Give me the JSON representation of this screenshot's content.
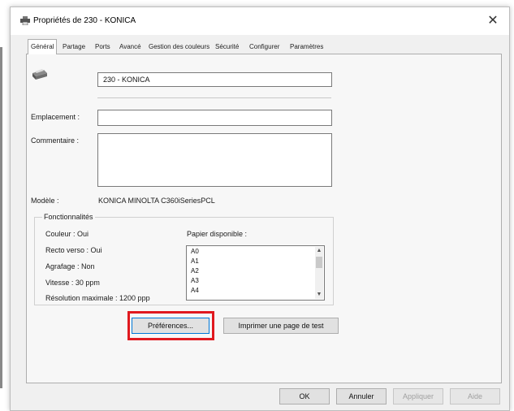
{
  "window": {
    "title": "Propriétés de 230 - KONICA",
    "close_symbol": "✕",
    "title_icon": "printer-icon"
  },
  "tabs": [
    {
      "label": "Général",
      "active": true
    },
    {
      "label": "Partage"
    },
    {
      "label": "Ports"
    },
    {
      "label": "Avancé"
    },
    {
      "label": "Gestion des couleurs"
    },
    {
      "label": "Sécurité"
    },
    {
      "label": "Configurer"
    },
    {
      "label": "Paramètres"
    }
  ],
  "general": {
    "printer_name": "230 - KONICA",
    "location_label": "Emplacement :",
    "location_value": "",
    "comment_label": "Commentaire :",
    "comment_value": "",
    "model_label": "Modèle :",
    "model_value": "KONICA MINOLTA C360iSeriesPCL",
    "features": {
      "title": "Fonctionnalités",
      "color": "Couleur : Oui",
      "duplex": "Recto verso : Oui",
      "staple": "Agrafage : Non",
      "speed": "Vitesse : 30 ppm",
      "resolution": "Résolution maximale : 1200 ppp",
      "paper_label": "Papier disponible :",
      "papers": [
        "A0",
        "A1",
        "A2",
        "A3",
        "A4"
      ]
    },
    "preferences_button": "Préférences...",
    "test_page_button": "Imprimer une page de test"
  },
  "footer": {
    "ok": "OK",
    "cancel": "Annuler",
    "apply": "Appliquer",
    "help": "Aide"
  },
  "colors": {
    "highlight": "#e0191f",
    "default_button_border": "#0078d7"
  }
}
